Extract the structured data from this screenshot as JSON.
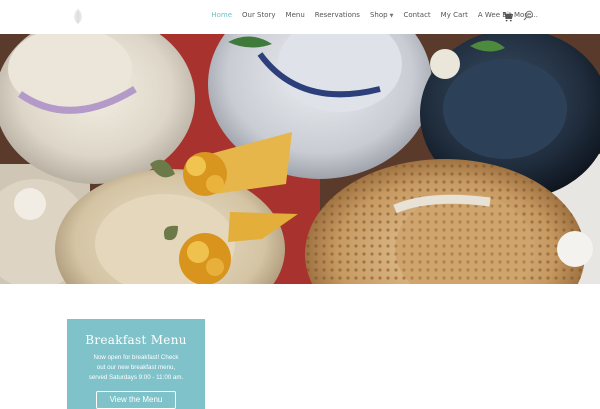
{
  "nav": {
    "items": [
      {
        "label": "Home",
        "active": true
      },
      {
        "label": "Our Story"
      },
      {
        "label": "Menu"
      },
      {
        "label": "Reservations"
      },
      {
        "label": "Shop",
        "has_dropdown": true
      },
      {
        "label": "Contact"
      },
      {
        "label": "My Cart"
      },
      {
        "label": "A Wee Bit More..."
      }
    ],
    "icons": [
      "logo-leaf-icon",
      "cart-icon",
      "search-icon"
    ],
    "active_color": "#74c0c4"
  },
  "hero": {
    "image_subject": "assorted straw and fabric hats with flowers and ribbons"
  },
  "promo_card": {
    "title": "Breakfast Menu",
    "text": "Now open for breakfast! Check\nout our new breakfast menu,\nserved Saturdays 9:00 - 11:00 am.",
    "button_label": "View the Menu",
    "background": "#7fc2c9"
  }
}
